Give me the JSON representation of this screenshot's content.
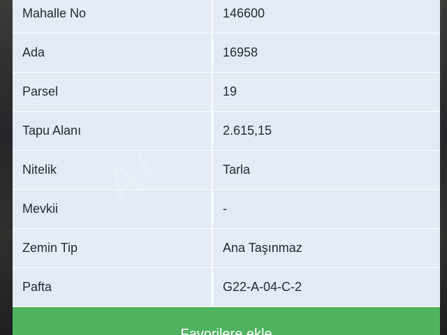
{
  "parcel_info": {
    "rows": [
      {
        "label": "Mahalle No",
        "value": "146600"
      },
      {
        "label": "Ada",
        "value": "16958"
      },
      {
        "label": "Parsel",
        "value": "19"
      },
      {
        "label": "Tapu Alanı",
        "value": "2.615,15"
      },
      {
        "label": "Nitelik",
        "value": "Tarla"
      },
      {
        "label": "Mevkii",
        "value": "-"
      },
      {
        "label": "Zemin Tip",
        "value": "Ana Taşınmaz"
      },
      {
        "label": "Pafta",
        "value": "G22-A-04-C-2"
      }
    ]
  },
  "watermark": "AI",
  "action_button": {
    "label": "Favorilere ekle"
  },
  "colors": {
    "panel_bg": "#e4ecf6",
    "button_green": "#4fb35f",
    "text": "#262a30"
  }
}
